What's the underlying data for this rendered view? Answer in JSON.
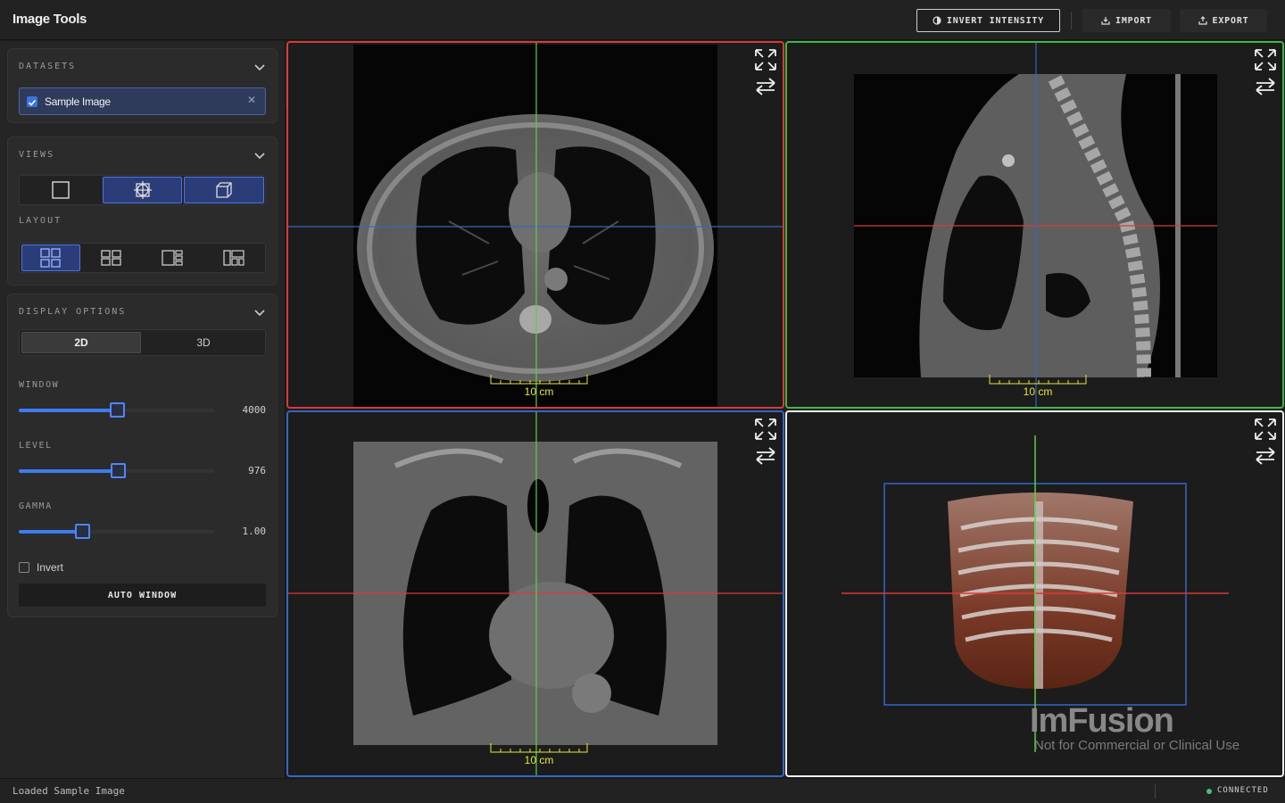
{
  "app": {
    "title": "Image Tools"
  },
  "toolbar": {
    "invert_label": "INVERT INTENSITY",
    "import_label": "IMPORT",
    "export_label": "EXPORT"
  },
  "sidebar": {
    "datasets": {
      "title": "DATASETS",
      "items": [
        {
          "label": "Sample Image",
          "checked": true
        }
      ]
    },
    "views": {
      "title": "VIEWS",
      "modes": [
        {
          "icon": "single-view-icon",
          "active": false
        },
        {
          "icon": "mpr-view-icon",
          "active": true
        },
        {
          "icon": "3d-view-icon",
          "active": true
        }
      ],
      "layout_title": "LAYOUT",
      "layouts": [
        {
          "icon": "layout-main-grid-icon",
          "active": true
        },
        {
          "icon": "layout-grid-icon",
          "active": false
        },
        {
          "icon": "layout-side-right-icon",
          "active": false
        },
        {
          "icon": "layout-side-left-icon",
          "active": false
        }
      ]
    },
    "display": {
      "title": "DISPLAY OPTIONS",
      "mode_2d": "2D",
      "mode_3d": "3D",
      "selected_mode": "2D",
      "window": {
        "label": "WINDOW",
        "value": "4000",
        "fraction": 0.5
      },
      "level": {
        "label": "LEVEL",
        "value": "976",
        "fraction": 0.505
      },
      "gamma": {
        "label": "GAMMA",
        "value": "1.00",
        "fraction": 0.325
      },
      "invert_label": "Invert",
      "invert_checked": false,
      "auto_window_label": "AUTO WINDOW"
    }
  },
  "viewports": {
    "axial": {
      "scale_label": "10 cm",
      "border_color": "#d83a3a"
    },
    "sagittal": {
      "scale_label": "10 cm",
      "border_color": "#40b840"
    },
    "coronal": {
      "scale_label": "10 cm",
      "border_color": "#3466c4"
    },
    "volume_3d": {
      "watermark_logo": "ImFusion",
      "watermark_text": "Not for Commercial or Clinical Use",
      "border_color": "#f0f0f0"
    }
  },
  "status": {
    "message": "Loaded Sample Image",
    "connection": "CONNECTED",
    "connection_color": "#3ec46d"
  },
  "colors": {
    "accent": "#3f7bf0",
    "crosshair_red": "#d83a3a",
    "crosshair_green": "#5ccf45",
    "crosshair_blue": "#3466c4",
    "scalebar": "#e6e63c"
  }
}
